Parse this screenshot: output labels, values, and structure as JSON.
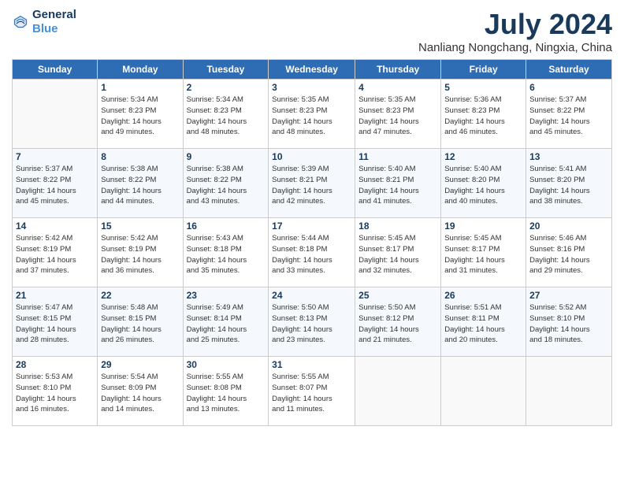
{
  "logo": {
    "line1": "General",
    "line2": "Blue"
  },
  "title": "July 2024",
  "subtitle": "Nanliang Nongchang, Ningxia, China",
  "weekdays": [
    "Sunday",
    "Monday",
    "Tuesday",
    "Wednesday",
    "Thursday",
    "Friday",
    "Saturday"
  ],
  "weeks": [
    [
      {
        "day": "",
        "info": ""
      },
      {
        "day": "1",
        "info": "Sunrise: 5:34 AM\nSunset: 8:23 PM\nDaylight: 14 hours\nand 49 minutes."
      },
      {
        "day": "2",
        "info": "Sunrise: 5:34 AM\nSunset: 8:23 PM\nDaylight: 14 hours\nand 48 minutes."
      },
      {
        "day": "3",
        "info": "Sunrise: 5:35 AM\nSunset: 8:23 PM\nDaylight: 14 hours\nand 48 minutes."
      },
      {
        "day": "4",
        "info": "Sunrise: 5:35 AM\nSunset: 8:23 PM\nDaylight: 14 hours\nand 47 minutes."
      },
      {
        "day": "5",
        "info": "Sunrise: 5:36 AM\nSunset: 8:23 PM\nDaylight: 14 hours\nand 46 minutes."
      },
      {
        "day": "6",
        "info": "Sunrise: 5:37 AM\nSunset: 8:22 PM\nDaylight: 14 hours\nand 45 minutes."
      }
    ],
    [
      {
        "day": "7",
        "info": "Sunrise: 5:37 AM\nSunset: 8:22 PM\nDaylight: 14 hours\nand 45 minutes."
      },
      {
        "day": "8",
        "info": "Sunrise: 5:38 AM\nSunset: 8:22 PM\nDaylight: 14 hours\nand 44 minutes."
      },
      {
        "day": "9",
        "info": "Sunrise: 5:38 AM\nSunset: 8:22 PM\nDaylight: 14 hours\nand 43 minutes."
      },
      {
        "day": "10",
        "info": "Sunrise: 5:39 AM\nSunset: 8:21 PM\nDaylight: 14 hours\nand 42 minutes."
      },
      {
        "day": "11",
        "info": "Sunrise: 5:40 AM\nSunset: 8:21 PM\nDaylight: 14 hours\nand 41 minutes."
      },
      {
        "day": "12",
        "info": "Sunrise: 5:40 AM\nSunset: 8:20 PM\nDaylight: 14 hours\nand 40 minutes."
      },
      {
        "day": "13",
        "info": "Sunrise: 5:41 AM\nSunset: 8:20 PM\nDaylight: 14 hours\nand 38 minutes."
      }
    ],
    [
      {
        "day": "14",
        "info": "Sunrise: 5:42 AM\nSunset: 8:19 PM\nDaylight: 14 hours\nand 37 minutes."
      },
      {
        "day": "15",
        "info": "Sunrise: 5:42 AM\nSunset: 8:19 PM\nDaylight: 14 hours\nand 36 minutes."
      },
      {
        "day": "16",
        "info": "Sunrise: 5:43 AM\nSunset: 8:18 PM\nDaylight: 14 hours\nand 35 minutes."
      },
      {
        "day": "17",
        "info": "Sunrise: 5:44 AM\nSunset: 8:18 PM\nDaylight: 14 hours\nand 33 minutes."
      },
      {
        "day": "18",
        "info": "Sunrise: 5:45 AM\nSunset: 8:17 PM\nDaylight: 14 hours\nand 32 minutes."
      },
      {
        "day": "19",
        "info": "Sunrise: 5:45 AM\nSunset: 8:17 PM\nDaylight: 14 hours\nand 31 minutes."
      },
      {
        "day": "20",
        "info": "Sunrise: 5:46 AM\nSunset: 8:16 PM\nDaylight: 14 hours\nand 29 minutes."
      }
    ],
    [
      {
        "day": "21",
        "info": "Sunrise: 5:47 AM\nSunset: 8:15 PM\nDaylight: 14 hours\nand 28 minutes."
      },
      {
        "day": "22",
        "info": "Sunrise: 5:48 AM\nSunset: 8:15 PM\nDaylight: 14 hours\nand 26 minutes."
      },
      {
        "day": "23",
        "info": "Sunrise: 5:49 AM\nSunset: 8:14 PM\nDaylight: 14 hours\nand 25 minutes."
      },
      {
        "day": "24",
        "info": "Sunrise: 5:50 AM\nSunset: 8:13 PM\nDaylight: 14 hours\nand 23 minutes."
      },
      {
        "day": "25",
        "info": "Sunrise: 5:50 AM\nSunset: 8:12 PM\nDaylight: 14 hours\nand 21 minutes."
      },
      {
        "day": "26",
        "info": "Sunrise: 5:51 AM\nSunset: 8:11 PM\nDaylight: 14 hours\nand 20 minutes."
      },
      {
        "day": "27",
        "info": "Sunrise: 5:52 AM\nSunset: 8:10 PM\nDaylight: 14 hours\nand 18 minutes."
      }
    ],
    [
      {
        "day": "28",
        "info": "Sunrise: 5:53 AM\nSunset: 8:10 PM\nDaylight: 14 hours\nand 16 minutes."
      },
      {
        "day": "29",
        "info": "Sunrise: 5:54 AM\nSunset: 8:09 PM\nDaylight: 14 hours\nand 14 minutes."
      },
      {
        "day": "30",
        "info": "Sunrise: 5:55 AM\nSunset: 8:08 PM\nDaylight: 14 hours\nand 13 minutes."
      },
      {
        "day": "31",
        "info": "Sunrise: 5:55 AM\nSunset: 8:07 PM\nDaylight: 14 hours\nand 11 minutes."
      },
      {
        "day": "",
        "info": ""
      },
      {
        "day": "",
        "info": ""
      },
      {
        "day": "",
        "info": ""
      }
    ]
  ]
}
